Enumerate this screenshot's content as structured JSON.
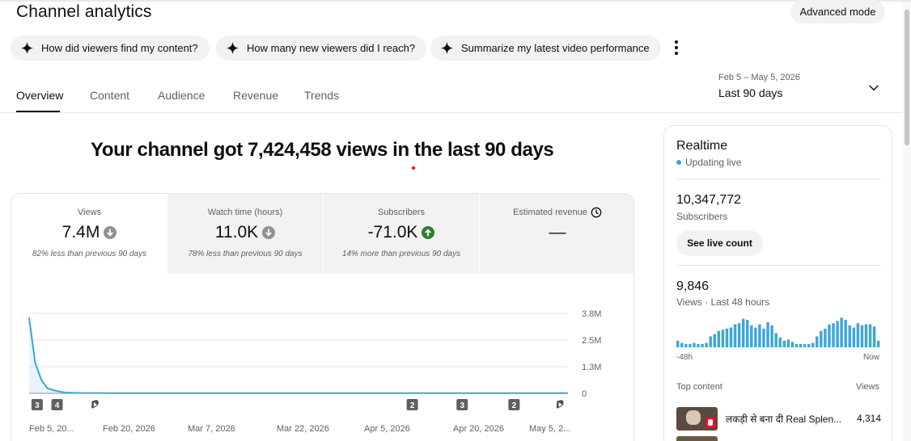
{
  "header": {
    "title": "Channel analytics",
    "advanced_mode_label": "Advanced mode"
  },
  "suggestions": [
    {
      "label": "How did viewers find my content?"
    },
    {
      "label": "How many new viewers did I reach?"
    },
    {
      "label": "Summarize my latest video performance"
    }
  ],
  "tabs": [
    {
      "label": "Overview",
      "active": true
    },
    {
      "label": "Content"
    },
    {
      "label": "Audience"
    },
    {
      "label": "Revenue"
    },
    {
      "label": "Trends"
    }
  ],
  "date_picker": {
    "range": "Feb 5 – May 5, 2026",
    "label": "Last 90 days"
  },
  "headline": "Your channel got 7,424,458 views in the last 90 days",
  "metrics": [
    {
      "label": "Views",
      "value": "7.4M",
      "trend": "down",
      "comparison": "82% less than previous 90 days"
    },
    {
      "label": "Watch time (hours)",
      "value": "11.0K",
      "trend": "down",
      "comparison": "78% less than previous 90 days"
    },
    {
      "label": "Subscribers",
      "value": "-71.0K",
      "trend": "up",
      "comparison": "14% more than previous 90 days"
    },
    {
      "label": "Estimated revenue",
      "value": "—",
      "trend": "pending",
      "comparison": ""
    }
  ],
  "colors": {
    "series": "#3ea6d6",
    "down_icon": "#909090",
    "up_icon": "#2e7d32",
    "badge": "#606060",
    "live_dot": "#3ea6d6"
  },
  "chart_data": {
    "type": "line",
    "series": [
      {
        "values": [
          3600000,
          1450000,
          650000,
          250000,
          150000,
          90000,
          40000,
          25000,
          20000,
          15000,
          14000,
          14000,
          14000,
          13000,
          13000,
          13000,
          12000,
          12000,
          12000,
          12000,
          12000,
          12000,
          12000,
          12000,
          12000,
          12000,
          12000,
          12000,
          12000,
          12000,
          12000,
          12000,
          12000,
          12000,
          12000,
          12000,
          12000,
          12000,
          12000,
          12000,
          12000,
          12000,
          12000,
          12000,
          12000,
          12000,
          12000,
          12000,
          12000,
          12000,
          12000,
          12000,
          12000,
          12000,
          12000,
          12000,
          12000,
          12000,
          12000,
          12000,
          12000,
          12000,
          12000,
          12000,
          12000,
          12000,
          12000,
          12000,
          12000,
          12000,
          12000,
          12000,
          12000,
          12000,
          12000,
          12000,
          12000,
          12000,
          12000,
          12000,
          12000,
          12000,
          12000,
          12000,
          12000,
          12000,
          12000,
          12000,
          12000,
          12000
        ]
      }
    ],
    "x_tick_labels": [
      "Feb 5, 20...",
      "Feb 20, 2026",
      "Mar 7, 2026",
      "Mar 22, 2026",
      "Apr 5, 2026",
      "Apr 20, 2026",
      "May 5, 2..."
    ],
    "y_tick_labels": [
      "3.8M",
      "2.5M",
      "1.3M",
      "0"
    ],
    "ylim": [
      0,
      3800000
    ],
    "grid": true,
    "markers": [
      {
        "day": 4,
        "type": "count",
        "label": "3"
      },
      {
        "day": 14,
        "type": "count",
        "label": "4"
      },
      {
        "day": 33,
        "type": "shorts"
      },
      {
        "day": 192,
        "type": "count",
        "label": "2"
      },
      {
        "day": 217,
        "type": "count",
        "label": "3"
      },
      {
        "day": 243,
        "type": "count",
        "label": "2"
      },
      {
        "day": 266,
        "type": "shorts"
      }
    ]
  },
  "realtime": {
    "title": "Realtime",
    "status": "Updating live",
    "subscribers_value": "10,347,772",
    "subscribers_label": "Subscribers",
    "see_live_label": "See live count",
    "views_value": "9,846",
    "views_label": "Views · Last 48 hours",
    "axis_start": "-48h",
    "axis_end": "Now",
    "bars": [
      6,
      4,
      3,
      3,
      4,
      3,
      3,
      4,
      10,
      12,
      15,
      16,
      17,
      18,
      21,
      22,
      26,
      25,
      20,
      18,
      21,
      17,
      23,
      20,
      13,
      9,
      6,
      7,
      5,
      3,
      3,
      3,
      3,
      4,
      10,
      15,
      17,
      21,
      22,
      24,
      27,
      25,
      20,
      18,
      22,
      20,
      21,
      21,
      19,
      6
    ],
    "top_content_header": "Top content",
    "views_col_header": "Views",
    "top_content": [
      {
        "title": "लकड़ी से बना दी Real Splen...",
        "views": "4,314"
      }
    ]
  }
}
